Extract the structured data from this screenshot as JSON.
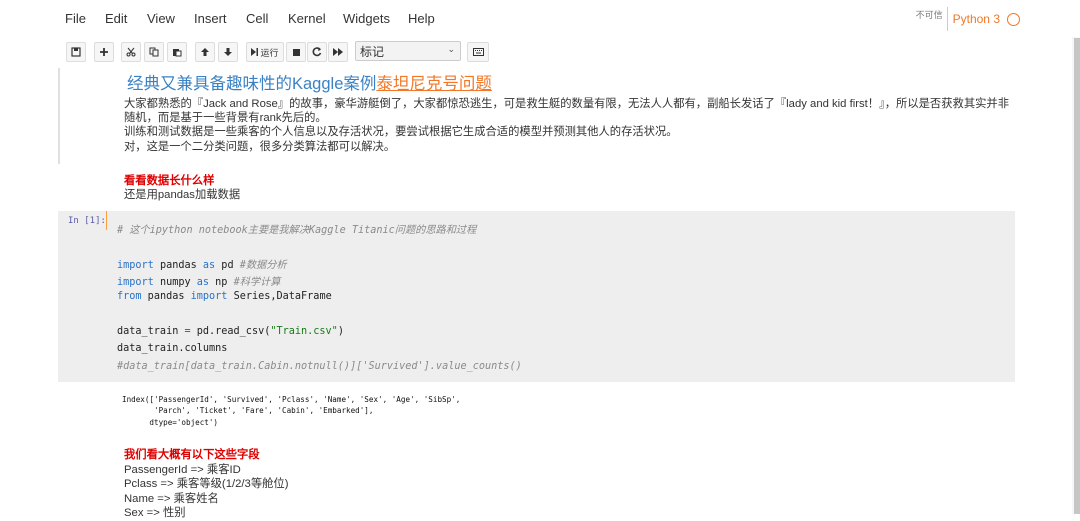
{
  "menubar": {
    "items": [
      "File",
      "Edit",
      "View",
      "Insert",
      "Cell",
      "Kernel",
      "Widgets",
      "Help"
    ],
    "trust": "不可信",
    "kernel": "Python 3"
  },
  "toolbar": {
    "run_label": "运行",
    "cell_type": "标记"
  },
  "cells": {
    "md1": {
      "title_main": "经典又兼具备趣味性的Kaggle案例",
      "title_highlight": "泰坦尼克号问题",
      "line1": "大家都熟悉的『Jack and Rose』的故事，豪华游艇倒了，大家都惊恐逃生，可是救生艇的数量有限，无法人人都有，副船长发话了『lady and kid first！』，所以是否获救其实并非",
      "line2": "随机，而是基于一些背景有rank先后的。",
      "line3": "训练和测试数据是一些乘客的个人信息以及存活状况，要尝试根据它生成合适的模型并预测其他人的存活状况。",
      "line4": "对，这是一个二分类问题，很多分类算法都可以解决。"
    },
    "md2": {
      "heading": "看看数据长什么样",
      "text": "还是用pandas加载数据"
    },
    "code": {
      "prompt": "In [1]:",
      "comment1": "# 这个ipython notebook主要是我解决Kaggle Titanic问题的思路和过程",
      "l_import": "import",
      "l_pandas": " pandas ",
      "l_as": "as",
      "l_pd": " pd ",
      "l_pd_cm": "#数据分析",
      "l_numpy": " numpy ",
      "l_np": " np ",
      "l_np_cm": "#科学计算",
      "l_from": "from",
      "l_from_mod": " pandas ",
      "l_from_names": " Series,DataFrame",
      "l_read1": "data_train ",
      "l_eq": "=",
      "l_read2": " pd.read_csv(",
      "l_read_str": "\"Train.csv\"",
      "l_read3": ")",
      "l_cols": "data_train.columns",
      "l_last_cm": "#data_train[data_train.Cabin.notnull()]['Survived'].value_counts()"
    },
    "output": {
      "line1": "Index(['PassengerId', 'Survived', 'Pclass', 'Name', 'Sex', 'Age', 'SibSp',",
      "line2": "       'Parch', 'Ticket', 'Fare', 'Cabin', 'Embarked'],",
      "line3": "      dtype='object')"
    },
    "md3": {
      "heading": "我们看大概有以下这些字段",
      "f1": "PassengerId => 乘客ID",
      "f2": "Pclass => 乘客等级(1/2/3等舱位)",
      "f3": "Name => 乘客姓名",
      "f4": "Sex => 性别"
    }
  }
}
